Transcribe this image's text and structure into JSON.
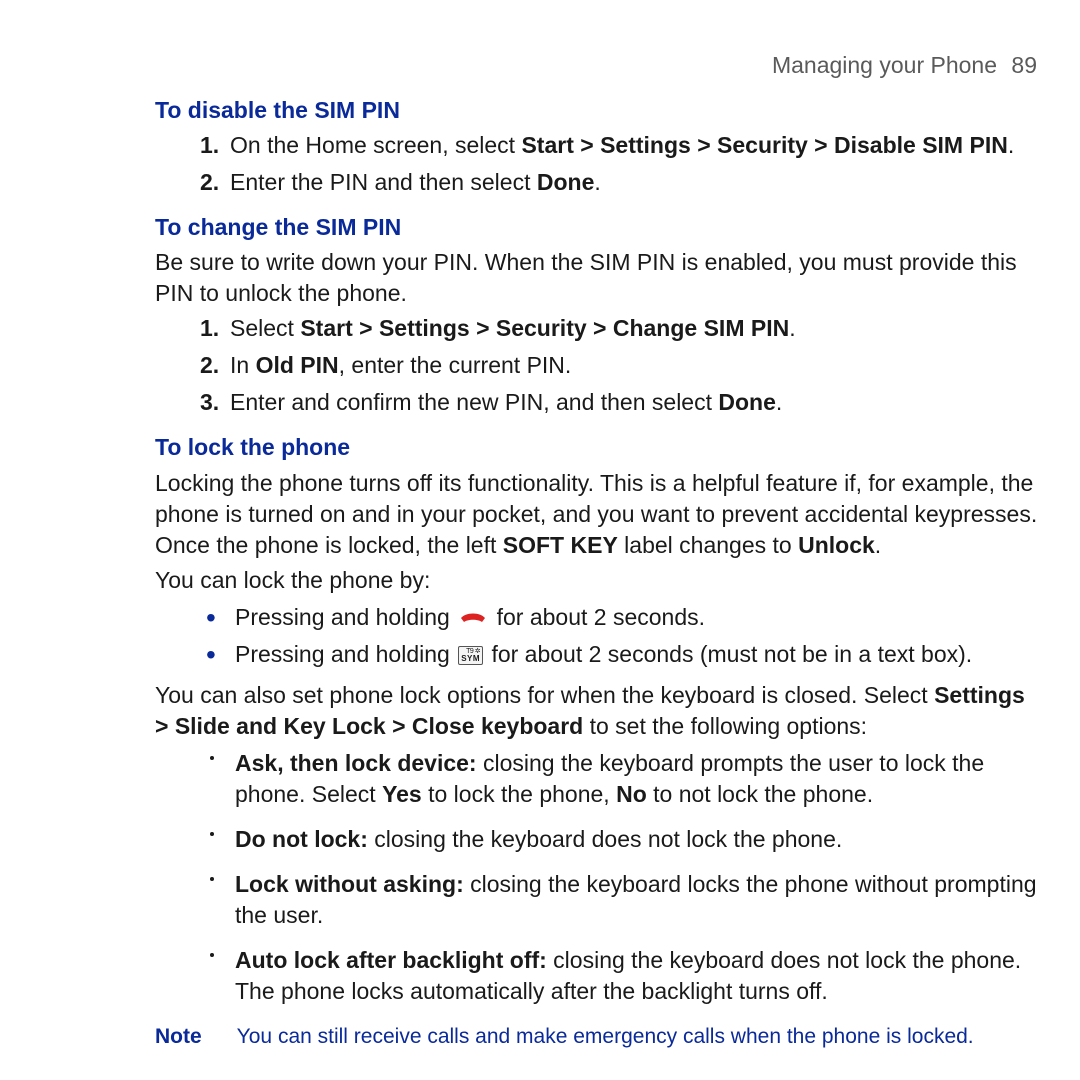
{
  "header": {
    "title": "Managing your Phone",
    "page": "89"
  },
  "s1": {
    "title": "To disable the SIM PIN",
    "items": [
      {
        "num": "1.",
        "pre": "On the Home screen, select ",
        "bold": "Start > Settings > Security > Disable SIM PIN",
        "post": "."
      },
      {
        "num": "2.",
        "pre": "Enter the PIN and then select ",
        "bold": "Done",
        "post": "."
      }
    ]
  },
  "s2": {
    "title": "To change the SIM PIN",
    "intro": "Be sure to write down your PIN. When the SIM PIN is enabled, you must provide this PIN to unlock the phone.",
    "items": [
      {
        "num": "1.",
        "pre": "Select ",
        "bold": "Start > Settings > Security > Change SIM PIN",
        "post": "."
      },
      {
        "num": "2.",
        "pre": "In ",
        "bold": "Old PIN",
        "post": ", enter the current PIN."
      },
      {
        "num": "3.",
        "pre": "Enter and confirm the new PIN, and then select ",
        "bold": "Done",
        "post": "."
      }
    ]
  },
  "s3": {
    "title": "To lock the phone",
    "p1a": "Locking the phone turns off its functionality. This is a helpful feature if, for example, the phone is turned on and in your pocket, and you want to prevent accidental keypresses. Once the phone is locked, the left ",
    "p1b": "SOFT KEY",
    "p1c": " label changes to ",
    "p1d": "Unlock",
    "p1e": ".",
    "p2": "You can lock the phone by:",
    "b1a": "Pressing and holding ",
    "b1b": " for about 2 seconds.",
    "b2a": "Pressing and holding ",
    "b2b": " for about 2 seconds (must not be in a text box).",
    "p3a": "You can also set phone lock options for when the keyboard is closed. Select ",
    "p3b": "Settings > Slide and Key Lock > Close keyboard",
    "p3c": " to set the following options:",
    "opts": [
      {
        "bold": "Ask, then lock device:",
        "pre": " closing the keyboard prompts the user to lock the phone. Select ",
        "b2": "Yes",
        "mid": " to lock the phone, ",
        "b3": "No",
        "post": " to not lock the phone."
      },
      {
        "bold": "Do not lock:",
        "pre": " closing the keyboard does not lock the phone.",
        "b2": "",
        "mid": "",
        "b3": "",
        "post": ""
      },
      {
        "bold": "Lock without asking:",
        "pre": " closing the keyboard locks the phone without prompting the user.",
        "b2": "",
        "mid": "",
        "b3": "",
        "post": ""
      },
      {
        "bold": "Auto lock after backlight off:",
        "pre": " closing the keyboard does not lock the phone. The phone locks automatically after the backlight turns off.",
        "b2": "",
        "mid": "",
        "b3": "",
        "post": ""
      }
    ]
  },
  "note": {
    "label": "Note",
    "text": "You can still receive calls and make emergency calls when the phone is locked."
  },
  "sym_icon": {
    "top": "T9 ✲",
    "bot": "SYM"
  }
}
